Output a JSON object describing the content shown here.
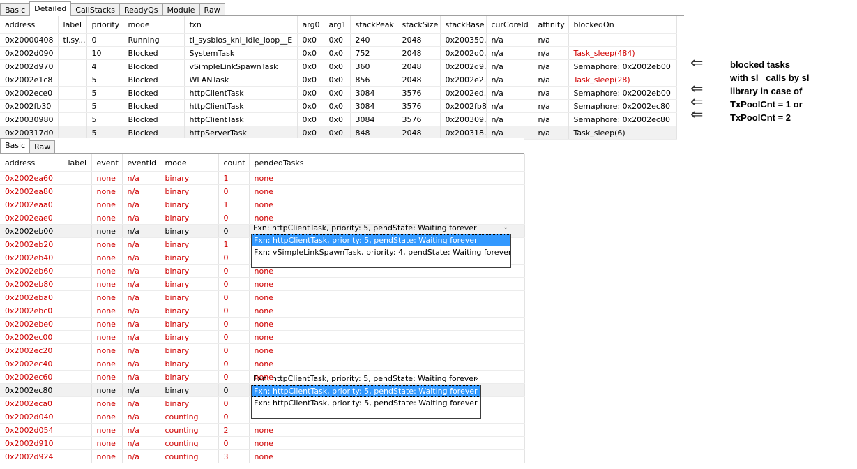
{
  "top_tabs": [
    "Basic",
    "Detailed",
    "CallStacks",
    "ReadyQs",
    "Module",
    "Raw"
  ],
  "top_active_tab": 1,
  "tasks": {
    "columns": [
      "address",
      "label",
      "priority",
      "mode",
      "fxn",
      "arg0",
      "arg1",
      "stackPeak",
      "stackSize",
      "stackBase",
      "curCoreId",
      "affinity",
      "blockedOn"
    ],
    "rows": [
      [
        "0x20000408",
        "ti.sy...",
        "0",
        "Running",
        "ti_sysbios_knl_Idle_loop__E",
        "0x0",
        "0x0",
        "240",
        "2048",
        "0x200350...",
        "n/a",
        "n/a",
        ""
      ],
      [
        "0x2002d090",
        "",
        "10",
        "Blocked",
        "SystemTask",
        "0x0",
        "0x0",
        "752",
        "2048",
        "0x2002d0...",
        "n/a",
        "n/a",
        "Task_sleep(484)"
      ],
      [
        "0x2002d970",
        "",
        "4",
        "Blocked",
        "vSimpleLinkSpawnTask",
        "0x0",
        "0x0",
        "360",
        "2048",
        "0x2002d9...",
        "n/a",
        "n/a",
        "Semaphore: 0x2002eb00"
      ],
      [
        "0x2002e1c8",
        "",
        "5",
        "Blocked",
        "WLANTask",
        "0x0",
        "0x0",
        "856",
        "2048",
        "0x2002e2...",
        "n/a",
        "n/a",
        "Task_sleep(28)"
      ],
      [
        "0x2002ece0",
        "",
        "5",
        "Blocked",
        "httpClientTask",
        "0x0",
        "0x0",
        "3084",
        "3576",
        "0x2002ed...",
        "n/a",
        "n/a",
        "Semaphore: 0x2002eb00"
      ],
      [
        "0x2002fb30",
        "",
        "5",
        "Blocked",
        "httpClientTask",
        "0x0",
        "0x0",
        "3084",
        "3576",
        "0x2002fb80",
        "n/a",
        "n/a",
        "Semaphore: 0x2002ec80"
      ],
      [
        "0x20030980",
        "",
        "5",
        "Blocked",
        "httpClientTask",
        "0x0",
        "0x0",
        "3084",
        "3576",
        "0x200309...",
        "n/a",
        "n/a",
        "Semaphore: 0x2002ec80"
      ],
      [
        "0x200317d0",
        "",
        "5",
        "Blocked",
        "httpServerTask",
        "0x0",
        "0x0",
        "848",
        "2048",
        "0x200318...",
        "n/a",
        "n/a",
        "Task_sleep(6)"
      ]
    ],
    "red_blocked_rows": [
      1,
      3
    ],
    "selected_row": 7
  },
  "sem_tabs": [
    "Basic",
    "Raw"
  ],
  "sem_active_tab": 0,
  "semaphores": {
    "columns": [
      "address",
      "label",
      "event",
      "eventId",
      "mode",
      "count",
      "pendedTasks"
    ],
    "rows": [
      [
        "0x2002ea60",
        "",
        "none",
        "n/a",
        "binary",
        "1",
        "none"
      ],
      [
        "0x2002ea80",
        "",
        "none",
        "n/a",
        "binary",
        "0",
        "none"
      ],
      [
        "0x2002eaa0",
        "",
        "none",
        "n/a",
        "binary",
        "1",
        "none"
      ],
      [
        "0x2002eae0",
        "",
        "none",
        "n/a",
        "binary",
        "0",
        "none"
      ],
      [
        "0x2002eb00",
        "",
        "none",
        "n/a",
        "binary",
        "0",
        ""
      ],
      [
        "0x2002eb20",
        "",
        "none",
        "n/a",
        "binary",
        "1",
        ""
      ],
      [
        "0x2002eb40",
        "",
        "none",
        "n/a",
        "binary",
        "0",
        ""
      ],
      [
        "0x2002eb60",
        "",
        "none",
        "n/a",
        "binary",
        "0",
        "none"
      ],
      [
        "0x2002eb80",
        "",
        "none",
        "n/a",
        "binary",
        "0",
        "none"
      ],
      [
        "0x2002eba0",
        "",
        "none",
        "n/a",
        "binary",
        "0",
        "none"
      ],
      [
        "0x2002ebc0",
        "",
        "none",
        "n/a",
        "binary",
        "0",
        "none"
      ],
      [
        "0x2002ebe0",
        "",
        "none",
        "n/a",
        "binary",
        "0",
        "none"
      ],
      [
        "0x2002ec00",
        "",
        "none",
        "n/a",
        "binary",
        "0",
        "none"
      ],
      [
        "0x2002ec20",
        "",
        "none",
        "n/a",
        "binary",
        "0",
        "none"
      ],
      [
        "0x2002ec40",
        "",
        "none",
        "n/a",
        "binary",
        "0",
        "none"
      ],
      [
        "0x2002ec60",
        "",
        "none",
        "n/a",
        "binary",
        "0",
        "none"
      ],
      [
        "0x2002ec80",
        "",
        "none",
        "n/a",
        "binary",
        "0",
        ""
      ],
      [
        "0x2002eca0",
        "",
        "none",
        "n/a",
        "binary",
        "0",
        ""
      ],
      [
        "0x2002d040",
        "",
        "none",
        "n/a",
        "counting",
        "0",
        ""
      ],
      [
        "0x2002d054",
        "",
        "none",
        "n/a",
        "counting",
        "2",
        "none"
      ],
      [
        "0x2002d910",
        "",
        "none",
        "n/a",
        "counting",
        "0",
        "none"
      ],
      [
        "0x2002d924",
        "",
        "none",
        "n/a",
        "counting",
        "3",
        "none"
      ]
    ],
    "black_rows": [
      4,
      16
    ]
  },
  "dropdown1": {
    "value": "Fxn: httpClientTask, priority: 5, pendState: Waiting forever",
    "options": [
      "Fxn: httpClientTask, priority: 5, pendState: Waiting forever",
      "Fxn: vSimpleLinkSpawnTask, priority: 4, pendState: Waiting forever"
    ]
  },
  "dropdown2": {
    "value": "Fxn: httpClientTask, priority: 5, pendState: Waiting forever",
    "options": [
      "Fxn: httpClientTask, priority: 5, pendState: Waiting forever",
      "Fxn: httpClientTask, priority: 5, pendState: Waiting forever"
    ]
  },
  "annotation": [
    "blocked tasks",
    "with sl_ calls by sl",
    "library in case of",
    "TxPoolCnt = 1 or",
    "TxPoolCnt = 2"
  ],
  "arrow_glyph": "⇐",
  "colors": {
    "red": "#d00000",
    "highlight": "#3399ff"
  }
}
